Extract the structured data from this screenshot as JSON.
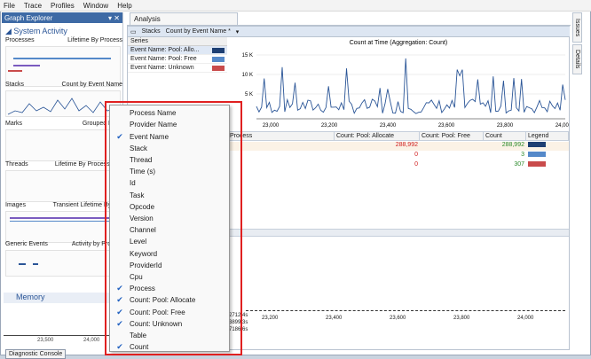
{
  "menubar": [
    "File",
    "Trace",
    "Profiles",
    "Window",
    "Help"
  ],
  "graph_explorer": {
    "title": "Graph Explorer",
    "section": "System Activity",
    "rows": [
      {
        "left": "Processes",
        "right": "Lifetime By Process"
      },
      {
        "left": "Stacks",
        "right": "Count by Event Name"
      },
      {
        "left": "Marks",
        "right": "Grouped By M"
      },
      {
        "left": "Threads",
        "right": "Lifetime By Process, Thr"
      },
      {
        "left": "Images",
        "right": "Transient Lifetime By Pro"
      },
      {
        "left": "Generic Events",
        "right": "Activity by Provide"
      }
    ],
    "memory": "Memory",
    "ticks": [
      "23,500",
      "24,000"
    ],
    "diagnostic": "Diagnostic Console"
  },
  "analysis": {
    "tab": "Analysis",
    "view_name": "Stacks",
    "view_preset": "Count by Event Name *",
    "series_header": "Series",
    "series": [
      {
        "name": "Event Name: Pool: Allo...",
        "color": "#1e3f73"
      },
      {
        "name": "Event Name: Pool: Free",
        "color": "#5589c9"
      },
      {
        "name": "Event Name: Unknown",
        "color": "#c94b4b"
      }
    ],
    "columns": [
      "Process",
      "Count: Pool: Allocate",
      "Count: Pool: Free",
      "Count",
      "Legend"
    ],
    "rows": [
      {
        "alloc": "288,992",
        "free": "",
        "count": "288,992",
        "color": "#1e3f73"
      },
      {
        "alloc": "0",
        "free": "",
        "count": "3",
        "color": "#5589c9"
      },
      {
        "alloc": "0",
        "free": "",
        "count": "307",
        "color": "#c94b4b"
      }
    ],
    "lower_ticks": [
      "23,200",
      "23,400",
      "23,600",
      "23,800",
      "24,000"
    ],
    "left_numbers": [
      "2712.4s",
      "3899.3s",
      "7186.6s"
    ]
  },
  "side_tabs": [
    "Issues",
    "Details"
  ],
  "chart_data": {
    "type": "line",
    "title": "Count at Time (Aggregation: Count)",
    "xlabel": "",
    "ylabel": "",
    "x": [
      23000,
      23100,
      23200,
      23300,
      23400,
      23500,
      23600,
      23650,
      23700,
      23800,
      23900,
      24000,
      24050
    ],
    "y_ticks": [
      "15 K",
      "10 K",
      "5 K"
    ],
    "x_ticks": [
      "23,000",
      "23,200",
      "23,400",
      "23,600",
      "23,800",
      "24,000"
    ],
    "ylim": [
      0,
      16000
    ]
  },
  "context_menu": {
    "items": [
      {
        "label": "Process Name",
        "checked": false
      },
      {
        "label": "Provider Name",
        "checked": false
      },
      {
        "label": "Event Name",
        "checked": true
      },
      {
        "label": "Stack",
        "checked": false
      },
      {
        "label": "Thread",
        "checked": false
      },
      {
        "label": "Time (s)",
        "checked": false
      },
      {
        "label": "Id",
        "checked": false
      },
      {
        "label": "Task",
        "checked": false
      },
      {
        "label": "Opcode",
        "checked": false
      },
      {
        "label": "Version",
        "checked": false
      },
      {
        "label": "Channel",
        "checked": false
      },
      {
        "label": "Level",
        "checked": false
      },
      {
        "label": "Keyword",
        "checked": false
      },
      {
        "label": "ProviderId",
        "checked": false
      },
      {
        "label": "Cpu",
        "checked": false
      },
      {
        "label": "Process",
        "checked": true
      },
      {
        "label": "Count: Pool: Allocate",
        "checked": true
      },
      {
        "label": "Count: Pool: Free",
        "checked": true
      },
      {
        "label": "Count: Unknown",
        "checked": true
      },
      {
        "label": "Table",
        "checked": false
      },
      {
        "label": "Count",
        "checked": true
      }
    ]
  }
}
